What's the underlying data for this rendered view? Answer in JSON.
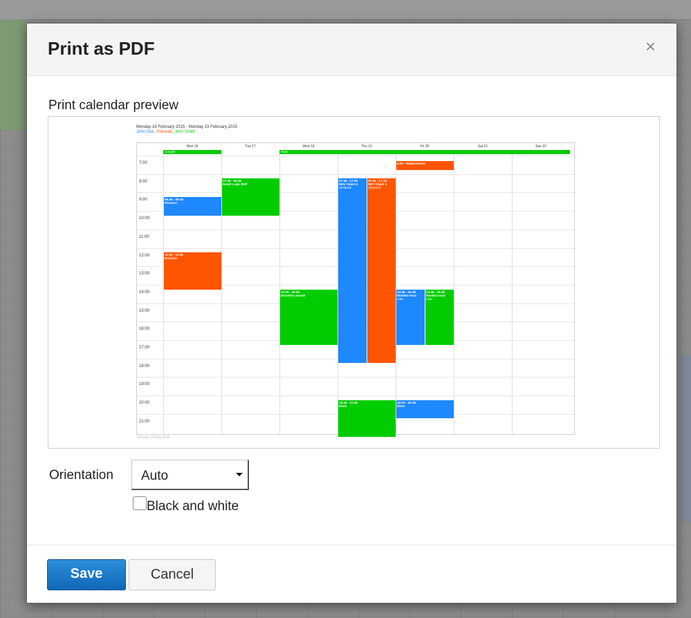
{
  "dialog": {
    "title": "Print as PDF",
    "close_glyph": "×",
    "preview_label": "Print calendar preview",
    "orientation_label": "Orientation",
    "orientation_value": "Auto",
    "bw_label": "Black and white",
    "save_label": "Save",
    "cancel_label": "Cancel"
  },
  "preview": {
    "range": "Monday 16 February 2015 - Monday 23 February 2015",
    "calendars": [
      {
        "name": "John Doe",
        "color": "#1e88ff"
      },
      {
        "name": "Volkandi",
        "color": "#ff5500"
      },
      {
        "name": "John Smith",
        "color": "#00cc00"
      }
    ],
    "footer": "Tuesday 20 Aug 2019",
    "days": [
      "Mon 16",
      "Tue 17",
      "Wed 18",
      "Thu 19",
      "Fri 20",
      "Sat 21",
      "Sun 22"
    ],
    "hours": [
      "7:00",
      "8:00",
      "9:00",
      "10:00",
      "11:00",
      "12:00",
      "13:00",
      "14:00",
      "15:00",
      "16:00",
      "17:00",
      "18:00",
      "19:00",
      "20:00",
      "21:00"
    ],
    "all_day_events": [
      {
        "day": 0,
        "span": 1,
        "title": "Congés",
        "color": "#00cc00"
      },
      {
        "day": 2,
        "span": 5,
        "title": "Paris",
        "color": "#00cc00"
      }
    ],
    "events": [
      {
        "day": 4,
        "start": 6.8,
        "end": 7.3,
        "time": "6:30 - Déplacement",
        "title": "",
        "color": "#ff5500"
      },
      {
        "day": 1,
        "start": 7.75,
        "end": 9.75,
        "time": "07:45 - 09:45",
        "title": "Rend'v sale RDP",
        "color": "#00cc00"
      },
      {
        "day": 0,
        "start": 8.75,
        "end": 9.75,
        "time": "08:45 - 09:45",
        "title": "Réunion",
        "color": "#1e88ff"
      },
      {
        "day": 3,
        "start": 7.75,
        "end": 17.75,
        "time": "07:45 - 17:45",
        "title": "RDV Client A",
        "sub": "Vendredi",
        "color": "#1e88ff",
        "half": 0
      },
      {
        "day": 3,
        "start": 7.75,
        "end": 17.75,
        "time": "07:45 - 17:45",
        "title": "RDV Client A",
        "sub": "Vendredi",
        "color": "#ff5500",
        "half": 1
      },
      {
        "day": 0,
        "start": 11.75,
        "end": 13.75,
        "time": "11:45 - 13:45",
        "title": "Réunion",
        "color": "#ff5500"
      },
      {
        "day": 2,
        "start": 13.75,
        "end": 16.75,
        "time": "13:45 - 16:45",
        "title": "Entretien annuel",
        "color": "#00cc00"
      },
      {
        "day": 4,
        "start": 13.75,
        "end": 16.75,
        "time": "13:45 - 16:45",
        "title": "Rendez-vous",
        "sub": "Inde",
        "color": "#1e88ff",
        "half": 0
      },
      {
        "day": 4,
        "start": 13.75,
        "end": 16.75,
        "time": "13:45 - 16:45",
        "title": "Rendez-vous",
        "sub": "Inde",
        "color": "#00cc00",
        "half": 1
      },
      {
        "day": 3,
        "start": 19.75,
        "end": 21.75,
        "time": "19:45 - 21:45",
        "title": "Dîner",
        "color": "#00cc00"
      },
      {
        "day": 4,
        "start": 19.75,
        "end": 20.75,
        "time": "19:45 - 20:45",
        "title": "Dîner",
        "color": "#1e88ff"
      }
    ]
  }
}
